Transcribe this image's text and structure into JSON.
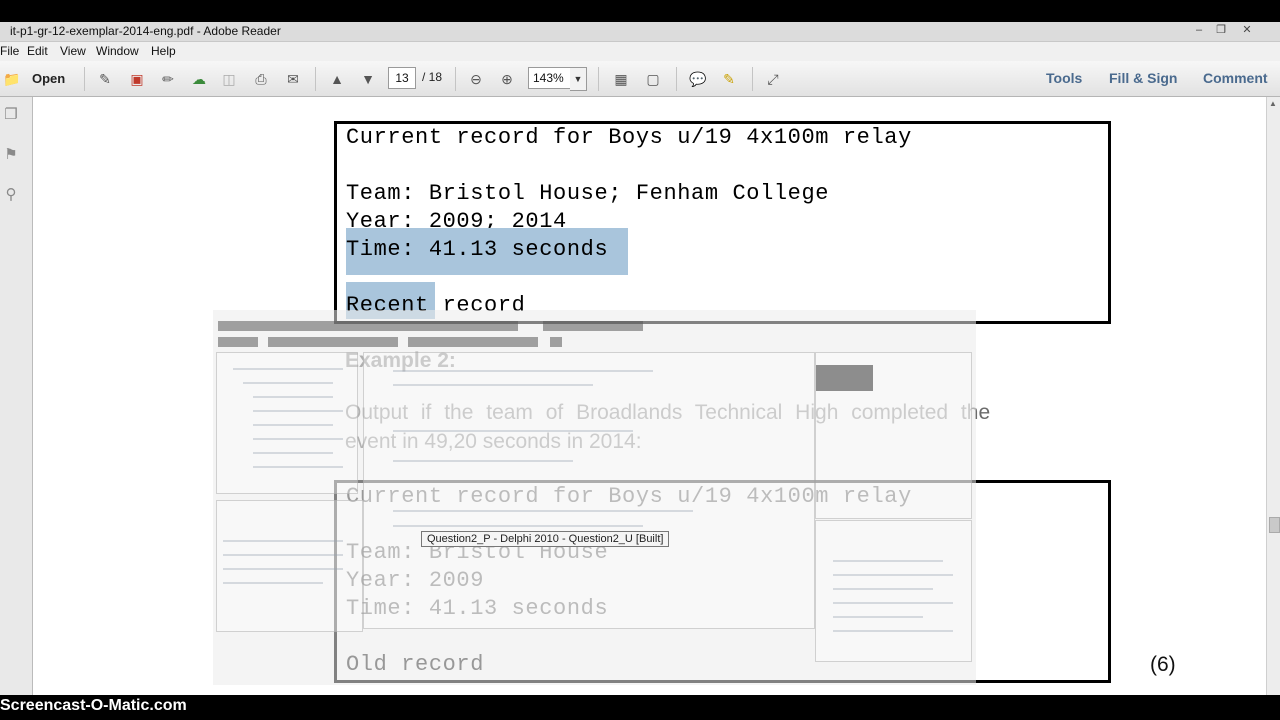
{
  "window": {
    "title": "it-p1-gr-12-exemplar-2014-eng.pdf - Adobe Reader"
  },
  "menu": [
    "File",
    "Edit",
    "View",
    "Window",
    "Help"
  ],
  "toolbar": {
    "open_label": "Open",
    "page_current": "13",
    "page_total": "/ 18",
    "zoom": "143%",
    "tools": "Tools",
    "fill_sign": "Fill & Sign",
    "comment": "Comment"
  },
  "document": {
    "box1": {
      "line1": "Current record for Boys u/19 4x100m relay",
      "line2": "Team: Bristol House; Fenham College",
      "line3": "Year: 2009; 2014",
      "line4": "Time: 41.13 seconds",
      "line5": "Recent record"
    },
    "example2_heading": "Example 2:",
    "para_line1": "Output if the team of Broadlands Technical High completed the",
    "para_line2": "event in 49,20 seconds in 2014:",
    "box2": {
      "line1": "Current record for Boys u/19 4x100m relay",
      "line2": "Team: Bristol House",
      "line3": "Year: 2009",
      "line4": "Time: 41.13 seconds",
      "line5": "Old record"
    },
    "marks": "(6)"
  },
  "overlay_tooltip": "Question2_P - Delphi 2010 - Question2_U [Built]",
  "watermark": "Screencast-O-Matic.com"
}
